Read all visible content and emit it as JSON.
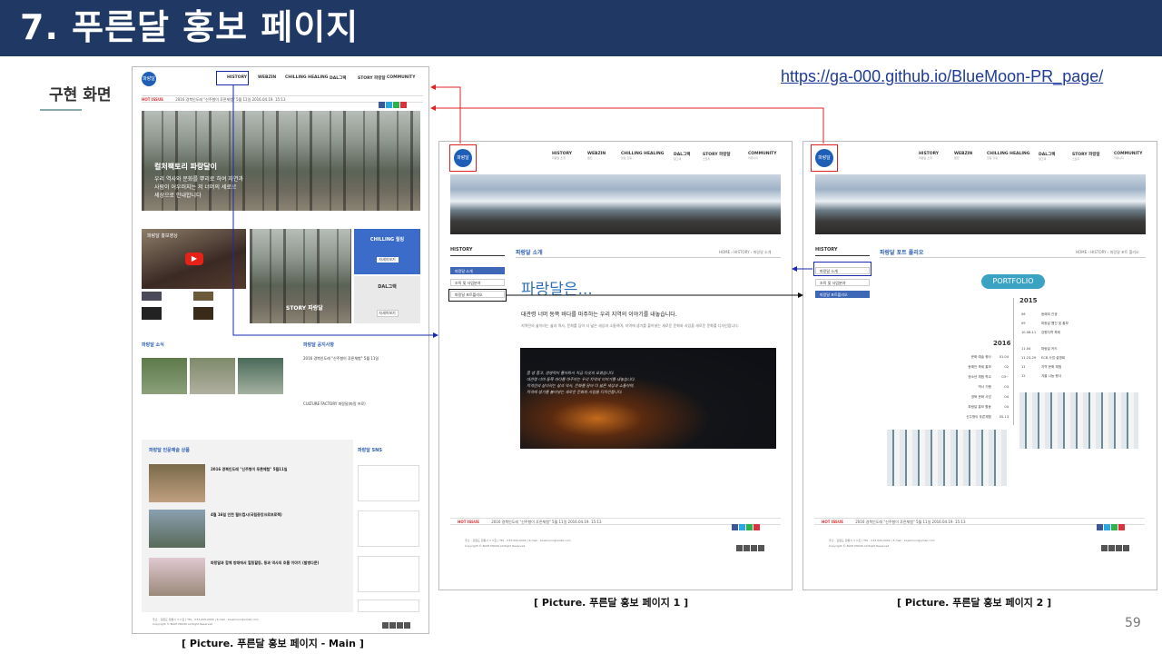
{
  "slide": {
    "title": "7. 푸른달 홍보 페이지",
    "section_label": "구현 화면",
    "url": "https://ga-000.github.io/BlueMoon-PR_page/",
    "page_number": "59"
  },
  "captions": {
    "main": "[ Picture. 푸른달 홍보 페이지 - Main ]",
    "page1": "[ Picture. 푸른달 홍보 페이지 1 ]",
    "page2": "[ Picture. 푸른달 홍보 페이지 2 ]"
  },
  "site": {
    "logo_text": "파랑달",
    "nav": [
      {
        "label": "HISTORY",
        "sub": "파랑달 소개"
      },
      {
        "label": "WEBZIN",
        "sub": "웹진"
      },
      {
        "label": "CHILLING HEALING",
        "sub": "칠링 힐링"
      },
      {
        "label": "DAL그랙",
        "sub": "달그랙"
      },
      {
        "label": "STORY 파랑달",
        "sub": "스토리"
      },
      {
        "label": "COMMUNITY",
        "sub": "커뮤니티"
      }
    ],
    "hot_issue_label": "HOT ISSUE",
    "hot_issue_text": "2016 경북인도레 \"신주형이 푸른체험\" 5월 11일 2016.04.19. 15:13",
    "social_colors": [
      "#3b5998",
      "#2aa9e0",
      "#2fb24c",
      "#d9333f"
    ]
  },
  "main_page": {
    "hero_title": "컬처팩토리 파랑달이",
    "hero_lines": [
      "우리 역사와 문화를 뿌리로 하여 자연과",
      "사람이 어우러지는 저 너머의 세로로",
      "세상으로 안내합니다"
    ],
    "video_title": "파랑달 홍보영상",
    "story_label": "STORY 파랑달",
    "chilling_card_title": "CHILLING 힐링",
    "chilling_card_button": "자세히보기",
    "dal_card_title": "DAL그랙",
    "dal_card_button": "자세히보기",
    "news_title": "파랑달 소식",
    "notice_title": "파랑달 공지사항",
    "notice_item": "2016 경북인도레 \"신주형이 푸른체험\" 5월 11일",
    "culture_factory": "CULTURE FACTORY 파랑달(파랑 프로)",
    "community_title": "파랑달 인문예술 상품",
    "sns_title": "파랑달 SNS",
    "community_items": [
      "2016 경북인도레 \"신주형이 푸른체험\" 5월11일",
      "4월 16일 인천 월드컵시(국립중앙크로프로젝)",
      "파랑달과 함께 방태에서 힐링할등, 동과 역사의 흐름 이야기 (발병다문)"
    ]
  },
  "sub_pages": {
    "sidebar_title": "HISTORY",
    "sidebar_items": [
      "파랑달 소개",
      "조직 및 사업분야",
      "파랑달 포트폴리오"
    ],
    "breadcrumb_home": "HOME",
    "breadcrumb_mid": "HISTORY",
    "page1": {
      "heading": "파랑달 소개",
      "script_title": "파랑달은...",
      "lead": "대관령 너머 동쪽 바다를 마주하는 우리 지역의 이야기를 내놓습니다.",
      "body": "지역민의 삶이라는 삶과 역사, 문화를 담아 더 넓은 세상과 소통하며, 지역에 생기를 불어넣는 새로운 문화와 사업을 새로운 문화를 디자인합니다.",
      "overlay_lines": [
        "품 생 품고, 경영력이 돌아와서 지금 다섯의 모였습니다.",
        "대관령 너머 동쪽 바다를 마주하는 우리 지역의 이야기를 내놓습니다.",
        "지역민의 삶이라는 삶과 역사, 문화를 담아 더 넓은 세상과 소통하며,",
        "지역에 생기를 불어넣는 새로운 문화와 사업을 디자인합니다."
      ]
    },
    "page2": {
      "heading": "파랑달 포트 폴리오",
      "pill": "PORTFOLIO",
      "year1": "2015",
      "year2": "2016",
      "right_rows": [
        {
          "date": "06",
          "text": "동해외 관광"
        },
        {
          "date": "09",
          "text": "파랑달 웹진 및 홍보"
        },
        {
          "date": "10.08-11",
          "text": "강원지역 축제"
        },
        {
          "date": "11.04",
          "text": "파랑달 카드"
        },
        {
          "date": "11.23-29",
          "text": "ECB 사업 설명회"
        },
        {
          "date": "11",
          "text": "지역 문화 체험"
        },
        {
          "date": "12",
          "text": "겨울 나눔 행사"
        }
      ],
      "left_rows": [
        {
          "date": "01.04",
          "text": "문화 예술 행사"
        },
        {
          "date": "02",
          "text": "동해안 축제 홍보"
        },
        {
          "date": "03~",
          "text": "청소년 체험 학교"
        },
        {
          "date": "03",
          "text": "역사 기행"
        },
        {
          "date": "04",
          "text": "경북 문화 사업"
        },
        {
          "date": "04",
          "text": "파랑달 홍보 활동"
        },
        {
          "date": "05.13",
          "text": "신주형이 푸른체험"
        }
      ]
    },
    "footer_text": "주소 : 강원도 강릉시 ㅇㅇ로 | TEL : 033-000-0000 | E-mail : bluemoon@email.com",
    "copyright": "Copyright © BLUE MOON All Right Reserved"
  }
}
